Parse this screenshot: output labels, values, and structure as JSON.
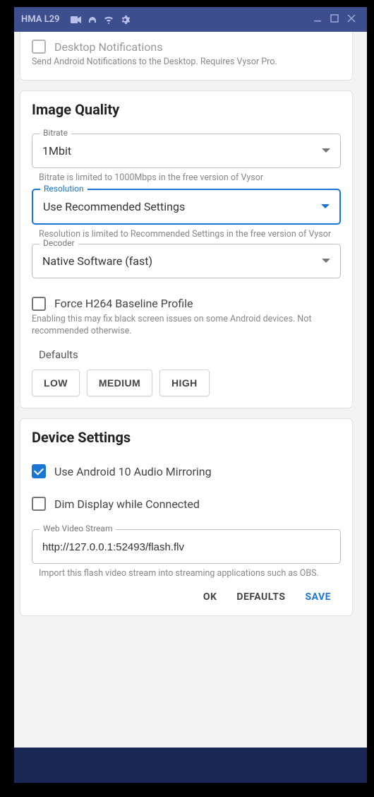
{
  "titlebar": {
    "title": "HMA L29"
  },
  "notif": {
    "label": "Desktop Notifications",
    "helper": "Send Android Notifications to the Desktop. Requires Vysor Pro."
  },
  "image_quality": {
    "title": "Image Quality",
    "bitrate": {
      "legend": "Bitrate",
      "value": "1Mbit",
      "helper": "Bitrate is limited to 1000Mbps in the free version of Vysor"
    },
    "resolution": {
      "legend": "Resolution",
      "value": "Use Recommended Settings",
      "helper": "Resolution is limited to Recommended Settings in the free version of Vysor"
    },
    "decoder": {
      "legend": "Decoder",
      "value": "Native Software (fast)"
    },
    "h264": {
      "label": "Force H264 Baseline Profile",
      "helper": "Enabling this may fix black screen issues on some Android devices. Not recommended otherwise."
    },
    "defaults_label": "Defaults",
    "presets": {
      "low": "LOW",
      "medium": "MEDIUM",
      "high": "HIGH"
    }
  },
  "device_settings": {
    "title": "Device Settings",
    "audio": "Use Android 10 Audio Mirroring",
    "dim": "Dim Display while Connected",
    "stream": {
      "legend": "Web Video Stream",
      "value": "http://127.0.0.1:52493/flash.flv",
      "helper": "Import this flash video stream into streaming applications such as OBS."
    }
  },
  "actions": {
    "ok": "OK",
    "defaults": "DEFAULTS",
    "save": "SAVE"
  }
}
